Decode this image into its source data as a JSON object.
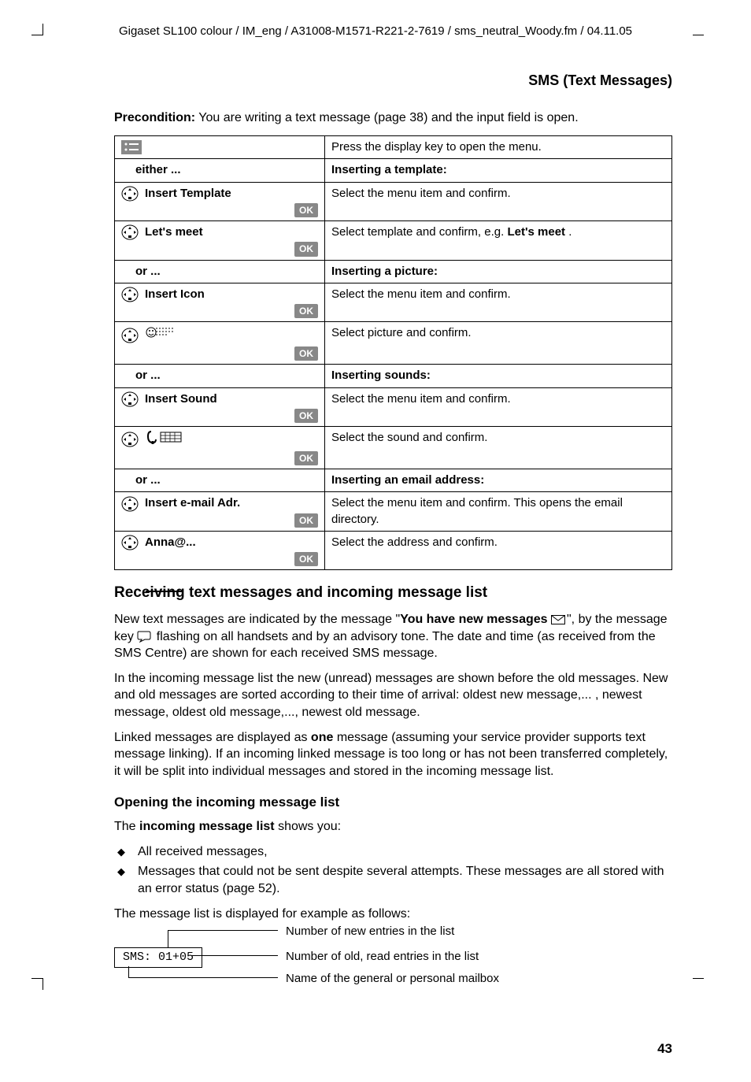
{
  "header": "Gigaset SL100 colour / IM_eng / A31008-M1571-R221-2-7619 / sms_neutral_Woody.fm / 04.11.05",
  "section_title": "SMS (Text Messages)",
  "precondition_label": "Precondition:",
  "precondition_text": " You are writing a text message (page 38) and the input field is open.",
  "table": {
    "ok": "OK",
    "either": "either ...",
    "or": "or ...",
    "rows": [
      {
        "left_type": "menu_icon",
        "right": "Press the display key to open the menu."
      },
      {
        "left_type": "header",
        "left": "either ...",
        "right_bold": "Inserting a template:"
      },
      {
        "left_type": "nav",
        "label": "Insert Template",
        "ok": true,
        "right": "Select the menu item and confirm."
      },
      {
        "left_type": "nav",
        "label": "Let's meet",
        "ok": true,
        "right_html": "Select template and confirm, e.g. <b>Let's meet</b> ."
      },
      {
        "left_type": "header",
        "left": "or ...",
        "right_bold": "Inserting a picture:"
      },
      {
        "left_type": "nav",
        "label": "Insert Icon",
        "ok": true,
        "right": "Select the menu item and confirm."
      },
      {
        "left_type": "nav_pic",
        "ok": true,
        "right": "Select picture and confirm."
      },
      {
        "left_type": "header",
        "left": "or ...",
        "right_bold": "Inserting sounds:"
      },
      {
        "left_type": "nav",
        "label": "Insert Sound",
        "ok": true,
        "right": "Select the menu item and confirm."
      },
      {
        "left_type": "nav_sound",
        "ok": true,
        "right": "Select the sound and confirm."
      },
      {
        "left_type": "header",
        "left": "or ...",
        "right_bold": "Inserting an email address:"
      },
      {
        "left_type": "nav",
        "label": "Insert e-mail Adr.",
        "ok": true,
        "right": "Select the menu item and confirm. This opens the email directory."
      },
      {
        "left_type": "nav",
        "label": "Anna@...",
        "ok": true,
        "right": "Select the address and confirm."
      }
    ]
  },
  "h2": "Receiving text messages and incoming message list",
  "para1_a": "New text messages are indicated by the message \"",
  "para1_b": "You have new messages ",
  "para1_c": "\", by the message key ",
  "para1_d": " flashing on all handsets and by an advisory tone. The date and time (as received from the SMS Centre) are shown for each received SMS message.",
  "para2": "In the incoming message list the new (unread) messages are shown before the old messages. New and old messages are sorted according to their time of arrival: oldest new message,... , newest message, oldest old message,..., newest old message.",
  "para3_a": "Linked messages are displayed as ",
  "para3_b": "one",
  "para3_c": " message (assuming your service provider supports text message linking). If an incoming linked message is too long or has not been transferred completely, it will be split into individual messages and stored in the incoming message list.",
  "h3": "Opening the incoming message list",
  "para4_a": "The ",
  "para4_b": "incoming message list",
  "para4_c": " shows you:",
  "bullets": [
    "All received messages,",
    "Messages that could not be sent despite several attempts. These messages are all stored with an error status (page 52)."
  ],
  "para5": "The message list is displayed for example as follows:",
  "diagram": {
    "box": "SMS:  01+05",
    "l1": "Number of new entries in the list",
    "l2": "Number of old, read entries in the list",
    "l3": "Name of the general or personal mailbox"
  },
  "page_number": "43"
}
